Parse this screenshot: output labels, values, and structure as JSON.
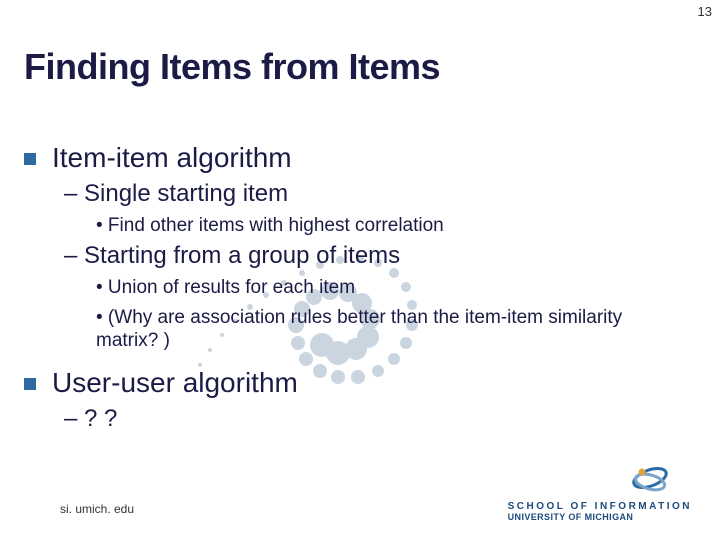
{
  "page_number": "13",
  "title": "Finding Items from Items",
  "bullets": {
    "item1": {
      "label": "Item-item algorithm",
      "sub1": {
        "label": "– Single starting item",
        "point1": "• Find other items with highest correlation"
      },
      "sub2": {
        "label": "– Starting from a group of items",
        "point1": "• Union of results for each item",
        "point2": "• (Why are association rules better than the item-item similarity matrix? )"
      }
    },
    "item2": {
      "label": "User-user algorithm",
      "sub1": {
        "label": "– ? ?"
      }
    }
  },
  "footer": {
    "url": "si. umich. edu",
    "brand_line1": "SCHOOL OF INFORMATION",
    "brand_line2": "UNIVERSITY OF MICHIGAN"
  }
}
